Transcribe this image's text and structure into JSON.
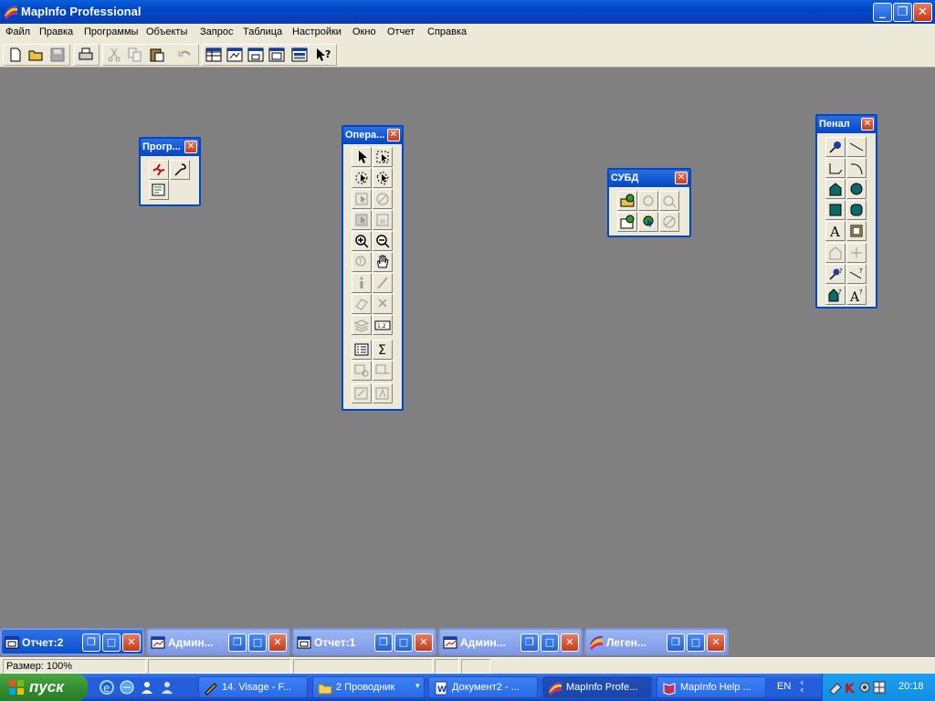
{
  "window": {
    "title": "MapInfo Professional",
    "minimize": "_",
    "maximize": "❐",
    "close": "✕"
  },
  "menu": [
    "Файл",
    "Правка",
    "Программы",
    "Объекты",
    "Запрос",
    "Таблица",
    "Настройки",
    "Окно",
    "Отчет",
    "Справка"
  ],
  "toolbar": {
    "tools": [
      "new-icon",
      "open-icon",
      "save-icon",
      "print-icon",
      "cut-icon",
      "copy-icon",
      "paste-icon",
      "undo-icon",
      "browser-icon",
      "map-icon",
      "graph-icon",
      "layout-icon",
      "redistrict-icon",
      "help-pointer-icon"
    ]
  },
  "palettes": {
    "programs": {
      "title": "Прогр...",
      "close": "✕"
    },
    "operations": {
      "title": "Опера...",
      "close": "✕"
    },
    "dbms": {
      "title": "СУБД",
      "close": "✕"
    },
    "drawing": {
      "title": "Пенал",
      "close": "✕"
    }
  },
  "minimized_windows": [
    {
      "label": "Отчет:2",
      "active": true
    },
    {
      "label": "Админ...",
      "active": false
    },
    {
      "label": "Отчет:1",
      "active": false
    },
    {
      "label": "Админ...",
      "active": false
    },
    {
      "label": "Леген...",
      "active": false
    }
  ],
  "statusbar": {
    "zoom": "Размер: 100%"
  },
  "taskbar": {
    "start": "пуск",
    "tasks": [
      {
        "label": "14. Visage - F...",
        "active": false
      },
      {
        "label": "2 Проводник",
        "active": false
      },
      {
        "label": "Документ2 - ...",
        "active": false
      },
      {
        "label": "MapInfo Profe...",
        "active": true
      },
      {
        "label": "MapInfo Help ...",
        "active": false
      }
    ],
    "language": "EN",
    "clock": "20:18"
  }
}
